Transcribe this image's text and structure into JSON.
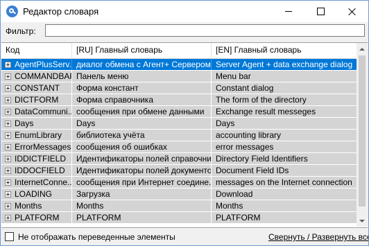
{
  "window": {
    "title": "Редактор словаря",
    "icon": "dictionary-app-icon"
  },
  "filter": {
    "label": "Фильтр:",
    "value": "",
    "placeholder": ""
  },
  "grid": {
    "columns": [
      "Код",
      "[RU] Главный словарь",
      "[EN] Главный словарь"
    ],
    "rows": [
      {
        "code": "AgentPlusServ...",
        "ru": "диалог обмена с Агент+ Сервером",
        "en": "Server Agent + data exchange dialog",
        "selected": true
      },
      {
        "code": "COMMANDBAR",
        "ru": "Панель меню",
        "en": "Menu bar"
      },
      {
        "code": "CONSTANT",
        "ru": "Форма констант",
        "en": "Constant dialog"
      },
      {
        "code": "DICTFORM",
        "ru": "Форма справочника",
        "en": "The form of the directory"
      },
      {
        "code": "DataCommuni...",
        "ru": "сообщения при обмене данными",
        "en": "Exchange result messeges"
      },
      {
        "code": "Days",
        "ru": "Days",
        "en": "Days"
      },
      {
        "code": "EnumLibrary",
        "ru": "библиотека учёта",
        "en": "accounting library"
      },
      {
        "code": "ErrorMessages",
        "ru": "сообщения об ошибках",
        "en": "error messages"
      },
      {
        "code": "IDDICTFIELD",
        "ru": "Идентификаторы полей справочни...",
        "en": "Directory Field Identifiers"
      },
      {
        "code": "IDDOCFIELD",
        "ru": "Идентификаторы полей документов",
        "en": "Document Field IDs"
      },
      {
        "code": "InternetConne...",
        "ru": "сообщения при Интернет соедине...",
        "en": "messages on the Internet connection"
      },
      {
        "code": "LOADING",
        "ru": "Загрузка",
        "en": "Download"
      },
      {
        "code": "Months",
        "ru": "Months",
        "en": "Months"
      },
      {
        "code": "PLATFORM",
        "ru": "PLATFORM",
        "en": "PLATFORM"
      }
    ]
  },
  "footer": {
    "hide_translated_label": "Не отображать переведенные элементы",
    "hide_translated_checked": false,
    "collapse_expand_link": "Свернуть / Развернуть все"
  },
  "colors": {
    "selection": "#0078d7",
    "row_background": "#d4d4d4",
    "window_border": "#6f9bd0"
  }
}
